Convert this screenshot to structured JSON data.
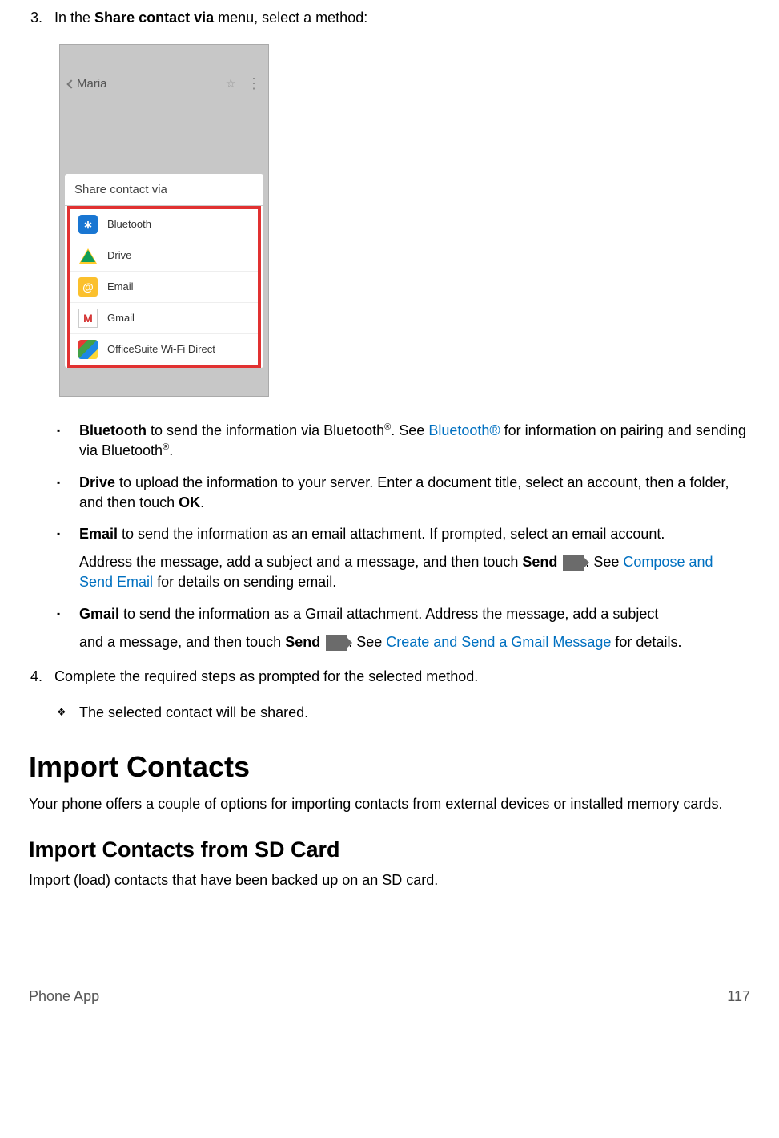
{
  "step3": {
    "num": "3.",
    "prefix": "In the ",
    "bold": "Share contact via",
    "suffix": " menu, select a method:"
  },
  "screenshot": {
    "back_label": "Maria",
    "dialog_title": "Share contact via",
    "options": [
      "Bluetooth",
      "Drive",
      "Email",
      "Gmail",
      "OfficeSuite Wi-Fi Direct"
    ]
  },
  "method_bt": {
    "bold": "Bluetooth",
    "text1": " to send the information via Bluetooth",
    "sup": "®",
    "text2": ". See ",
    "link": "Bluetooth®",
    "text3": " for information on pairing and sending via Bluetooth",
    "sup2": "®",
    "text4": "."
  },
  "method_drive": {
    "bold": "Drive",
    "text": " to upload the information to your server. Enter a document title, select an account, then a folder, and then touch ",
    "bold2": "OK",
    "text2": "."
  },
  "method_email": {
    "bold": "Email",
    "line1": " to send the information as an email attachment. If prompted, select an email account.",
    "line2a": "Address the message, add a subject and a message, and then touch ",
    "send": "Send",
    "line2b": ". See ",
    "link": "Compose and Send Email",
    "line2c": " for details on sending email."
  },
  "method_gmail": {
    "bold": "Gmail",
    "line1": " to send the information as a Gmail attachment. Address the message, add a subject",
    "line2a": "and a message, and then touch ",
    "send": "Send",
    "line2b": ". See ",
    "link": "Create and Send a Gmail Message",
    "line2c": " for details."
  },
  "step4": {
    "num": "4.",
    "text": "Complete the required steps as prompted for the selected method."
  },
  "result": "The selected contact will be shared.",
  "h1": "Import Contacts",
  "h1_intro": "Your phone offers a couple of options for importing contacts from external devices or installed memory cards.",
  "h2": "Import Contacts from SD Card",
  "h2_intro": "Import (load) contacts that have been backed up on an SD card.",
  "footer_left": "Phone App",
  "footer_right": "117"
}
